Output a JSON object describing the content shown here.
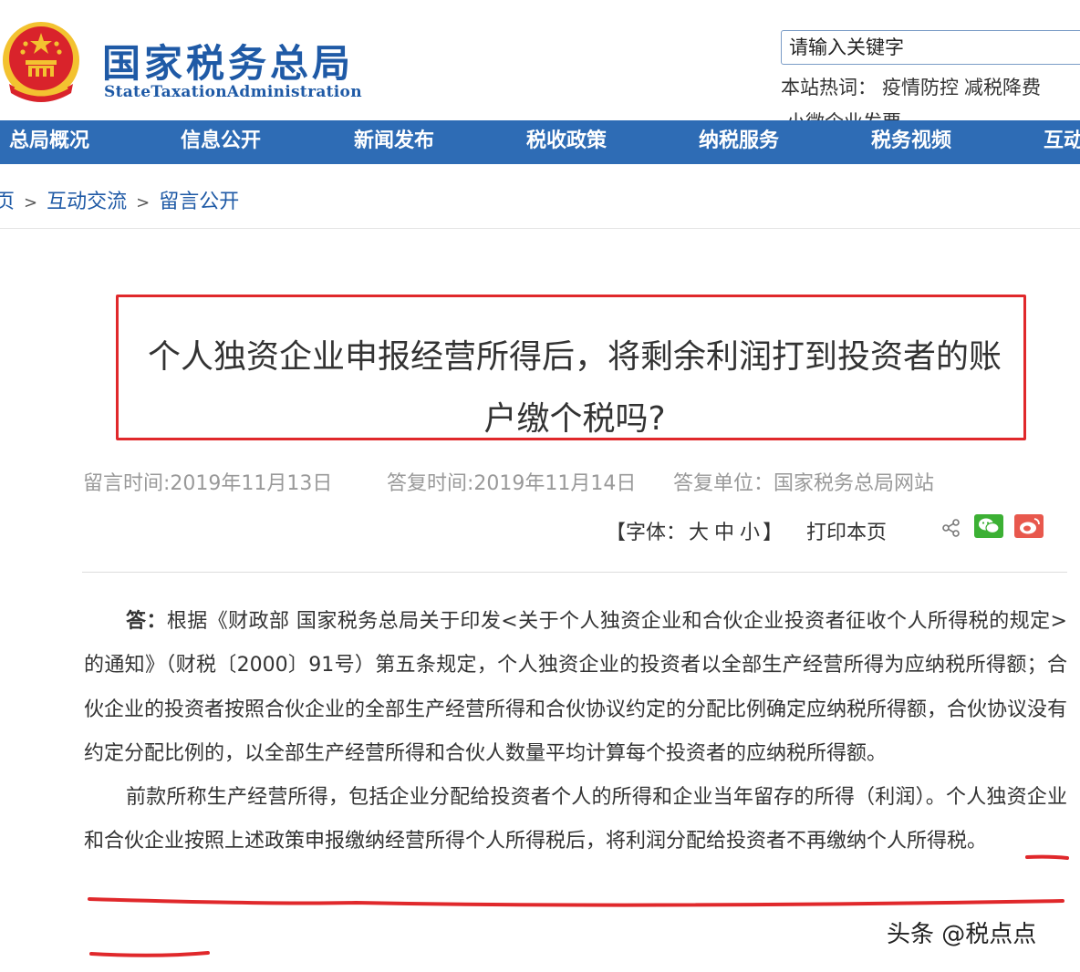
{
  "header": {
    "title_cn": "国家税务总局",
    "title_en": "StateTaxationAdministration",
    "search_placeholder": "请输入关键字",
    "hotwords_label": "本站热词：",
    "hotwords": [
      "疫情防控",
      "减税降费"
    ],
    "hotwords_more": "小微企业发票"
  },
  "nav": {
    "items": [
      "总局概况",
      "信息公开",
      "新闻发布",
      "税收政策",
      "纳税服务",
      "税务视频",
      "互动"
    ]
  },
  "breadcrumb": {
    "items": [
      "页",
      "互动交流",
      "留言公开"
    ],
    "separator": ">"
  },
  "article": {
    "title": "个人独资企业申报经营所得后，将剩余利润打到投资者的账户缴个税吗?",
    "message_time": "留言时间:2019年11月13日",
    "reply_time": "答复时间:2019年11月14日",
    "reply_unit": "答复单位：国家税务总局网站",
    "font_label": "【字体：",
    "font_large": "大",
    "font_medium": "中",
    "font_small": "小",
    "font_close": "】",
    "print_label": "打印本页",
    "answer_lead": "答：",
    "paragraph1": "根据《财政部 国家税务总局关于印发<关于个人独资企业和合伙企业投资者征收个人所得税的规定>的通知》（财税〔2000〕91号）第五条规定，个人独资企业的投资者以全部生产经营所得为应纳税所得额；合伙企业的投资者按照合伙企业的全部生产经营所得和合伙协议约定的分配比例确定应纳税所得额，合伙协议没有约定分配比例的，以全部生产经营所得和合伙人数量平均计算每个投资者的应纳税所得额。",
    "paragraph2a": "前款所称生产经营所得，包括企业分配给投资者个人的所得和企业当年留存的所得（利润）。",
    "paragraph2b": "个人独资企业和合伙企业按照上述政策申报缴纳经营所得个人所得税后，将利润分配给投资者不再缴纳个人所得税。"
  },
  "watermark": "头条 @税点点",
  "colors": {
    "brand_blue": "#1f5aa6",
    "nav_blue": "#2e6cb5",
    "highlight_red": "#e0282b",
    "emblem_red": "#d9232b",
    "emblem_gold": "#f3c230"
  }
}
